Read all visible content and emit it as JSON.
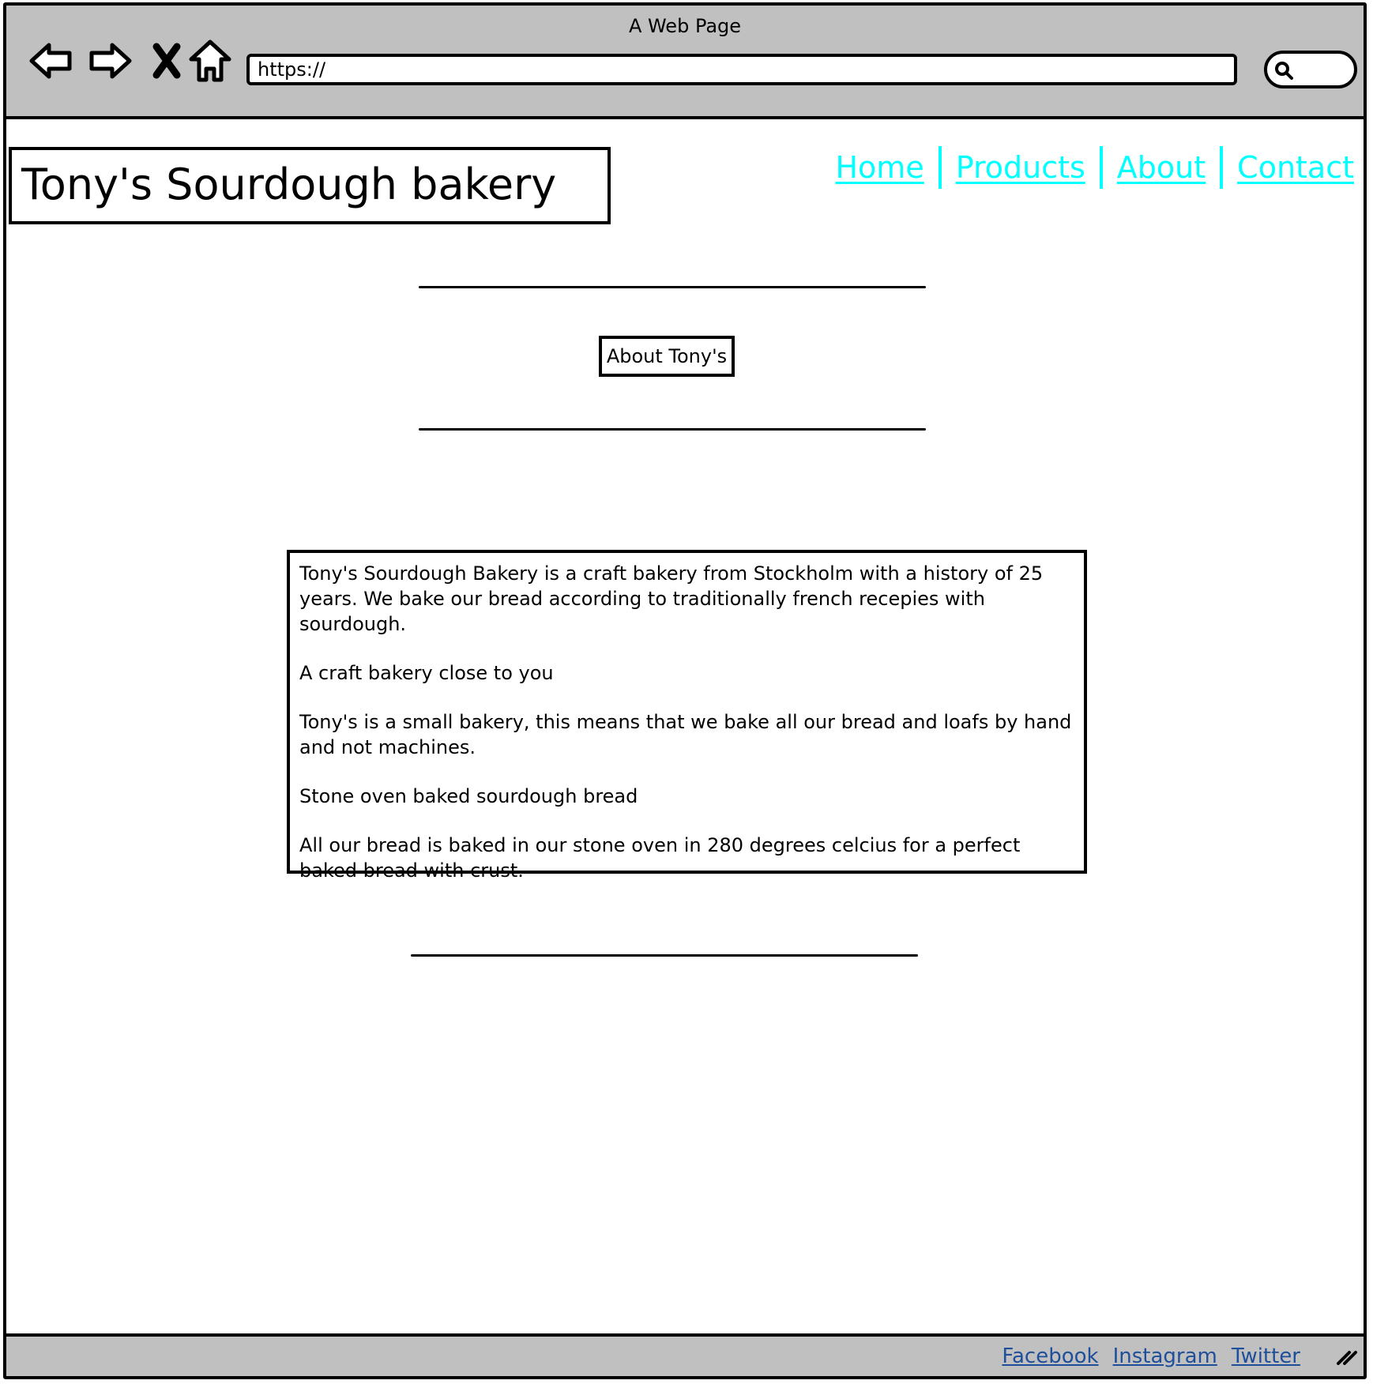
{
  "browser": {
    "window_title": "A Web Page",
    "address": "https://",
    "icons": {
      "back": "back-arrow-icon",
      "forward": "forward-arrow-icon",
      "stop": "close-x-icon",
      "home": "home-icon",
      "search": "search-icon"
    }
  },
  "header": {
    "logo": "Tony's Sourdough bakery"
  },
  "nav": {
    "items": [
      {
        "label": "Home"
      },
      {
        "label": "Products"
      },
      {
        "label": "About"
      },
      {
        "label": "Contact"
      }
    ],
    "color": "#00ffff"
  },
  "main": {
    "section_label": "About Tony's",
    "paragraphs": [
      "Tony's Sourdough Bakery is a craft bakery from Stockholm with a history of 25 years. We bake our bread according to traditionally french recepies with sourdough.",
      "A craft bakery close to you",
      "Tony's is a small bakery, this means that we bake all our bread and loafs by hand and not machines.",
      "Stone oven baked sourdough bread",
      "All our bread is baked in our stone oven in 280 degrees celcius for a perfect baked bread with crust."
    ]
  },
  "footer": {
    "links": [
      {
        "label": "Facebook"
      },
      {
        "label": "Instagram"
      },
      {
        "label": "Twitter"
      }
    ],
    "link_color": "#1f4e9a"
  }
}
